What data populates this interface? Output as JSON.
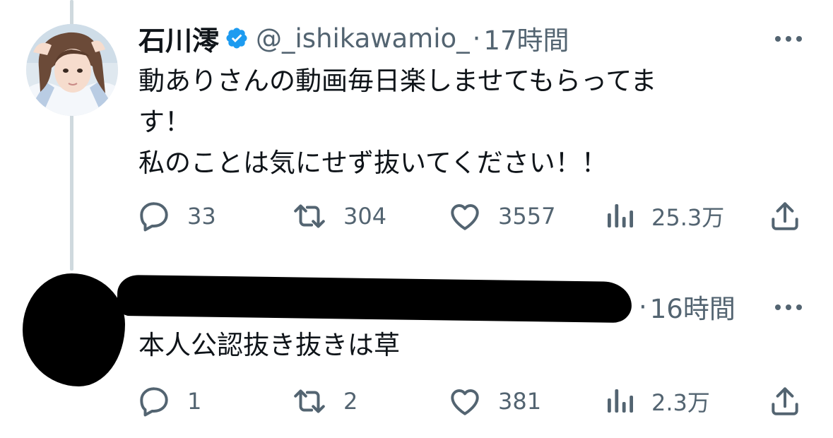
{
  "tweets": [
    {
      "display_name": "石川澪",
      "handle": "@_ishikawamio_",
      "separator": "·",
      "time": "17時間",
      "text": "動ありさんの動画毎日楽しませてもらってま\nす！\n私のことは気にせず抜いてください！！",
      "replies": "33",
      "retweets": "304",
      "likes": "3557",
      "views": "25.3万"
    },
    {
      "separator": "·",
      "time": "16時間",
      "text": "本人公認抜き抜きは草",
      "replies": "1",
      "retweets": "2",
      "likes": "381",
      "views": "2.3万"
    }
  ],
  "colors": {
    "text": "#0f1419",
    "secondary": "#536471",
    "verified": "#1d9bf0",
    "thread_line": "#cfd9de",
    "redaction": "#000000"
  },
  "icons": {
    "verified": "verified-badge-icon",
    "more": "more-dots-icon",
    "reply": "reply-icon",
    "retweet": "retweet-icon",
    "like": "heart-icon",
    "views": "views-bar-icon",
    "share": "share-icon"
  }
}
